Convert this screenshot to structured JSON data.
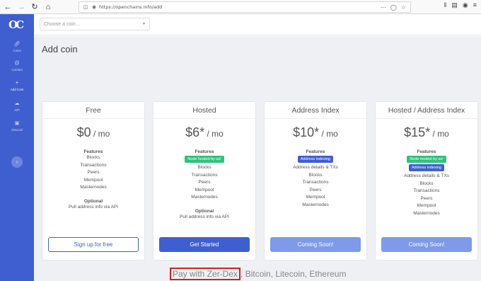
{
  "browser": {
    "url": "https://openchains.info/add",
    "back_icon": "arrow-left",
    "forward_icon": "arrow-right",
    "reload_icon": "reload",
    "home_icon": "home"
  },
  "sidebar": {
    "logo": "OC",
    "items": [
      {
        "label": "Coins",
        "icon": "link-icon"
      },
      {
        "label": "Contact",
        "icon": "at-icon"
      },
      {
        "label": "Add Coin",
        "icon": "plus-icon"
      },
      {
        "label": "API",
        "icon": "cloud-icon"
      },
      {
        "label": "Discord",
        "icon": "discord-icon"
      }
    ]
  },
  "topbar": {
    "coin_placeholder": "Choose a coin..."
  },
  "page": {
    "title": "Add coin"
  },
  "plans": [
    {
      "name": "Free",
      "price": "$0",
      "per": " / mo",
      "features_title": "Features",
      "badges": [],
      "features": [
        "Blocks",
        "Transactions",
        "Peers",
        "Mempool",
        "Masternodes"
      ],
      "optional_title": "Optional",
      "optional": [
        "Pull address info via API"
      ],
      "button": "Sign up for free"
    },
    {
      "name": "Hosted",
      "price": "$6*",
      "per": " / mo",
      "features_title": "Features",
      "badges": [
        "Node hosted by us!"
      ],
      "features": [
        "Blocks",
        "Transactions",
        "Peers",
        "Mempool",
        "Masternodes"
      ],
      "optional_title": "Optional",
      "optional": [
        "Pull address info via API"
      ],
      "button": "Get Started"
    },
    {
      "name": "Address Index",
      "price": "$10*",
      "per": " / mo",
      "features_title": "Features",
      "badges": [
        "Address indexing"
      ],
      "features": [
        "Address details & TXs",
        "Blocks",
        "Transactions",
        "Peers",
        "Mempool",
        "Masternodes"
      ],
      "button": "Coming Soon!"
    },
    {
      "name": "Hosted / Address Index",
      "price": "$15*",
      "per": " / mo",
      "features_title": "Features",
      "badges": [
        "Node hosted by us!",
        "Address indexing"
      ],
      "features": [
        "Address details & TXs",
        "Blocks",
        "Transactions",
        "Peers",
        "Mempool",
        "Masternodes"
      ],
      "button": "Coming Soon!"
    }
  ],
  "payment": {
    "highlighted": "Pay with Zer-Dex",
    "rest": ", Bitcoin, Litecoin, Ethereum"
  },
  "colors": {
    "brand": "#3f5fd0",
    "badge_green": "#2ec27e",
    "coming_soon": "#7e9ae8",
    "highlight_border": "#d32020"
  }
}
